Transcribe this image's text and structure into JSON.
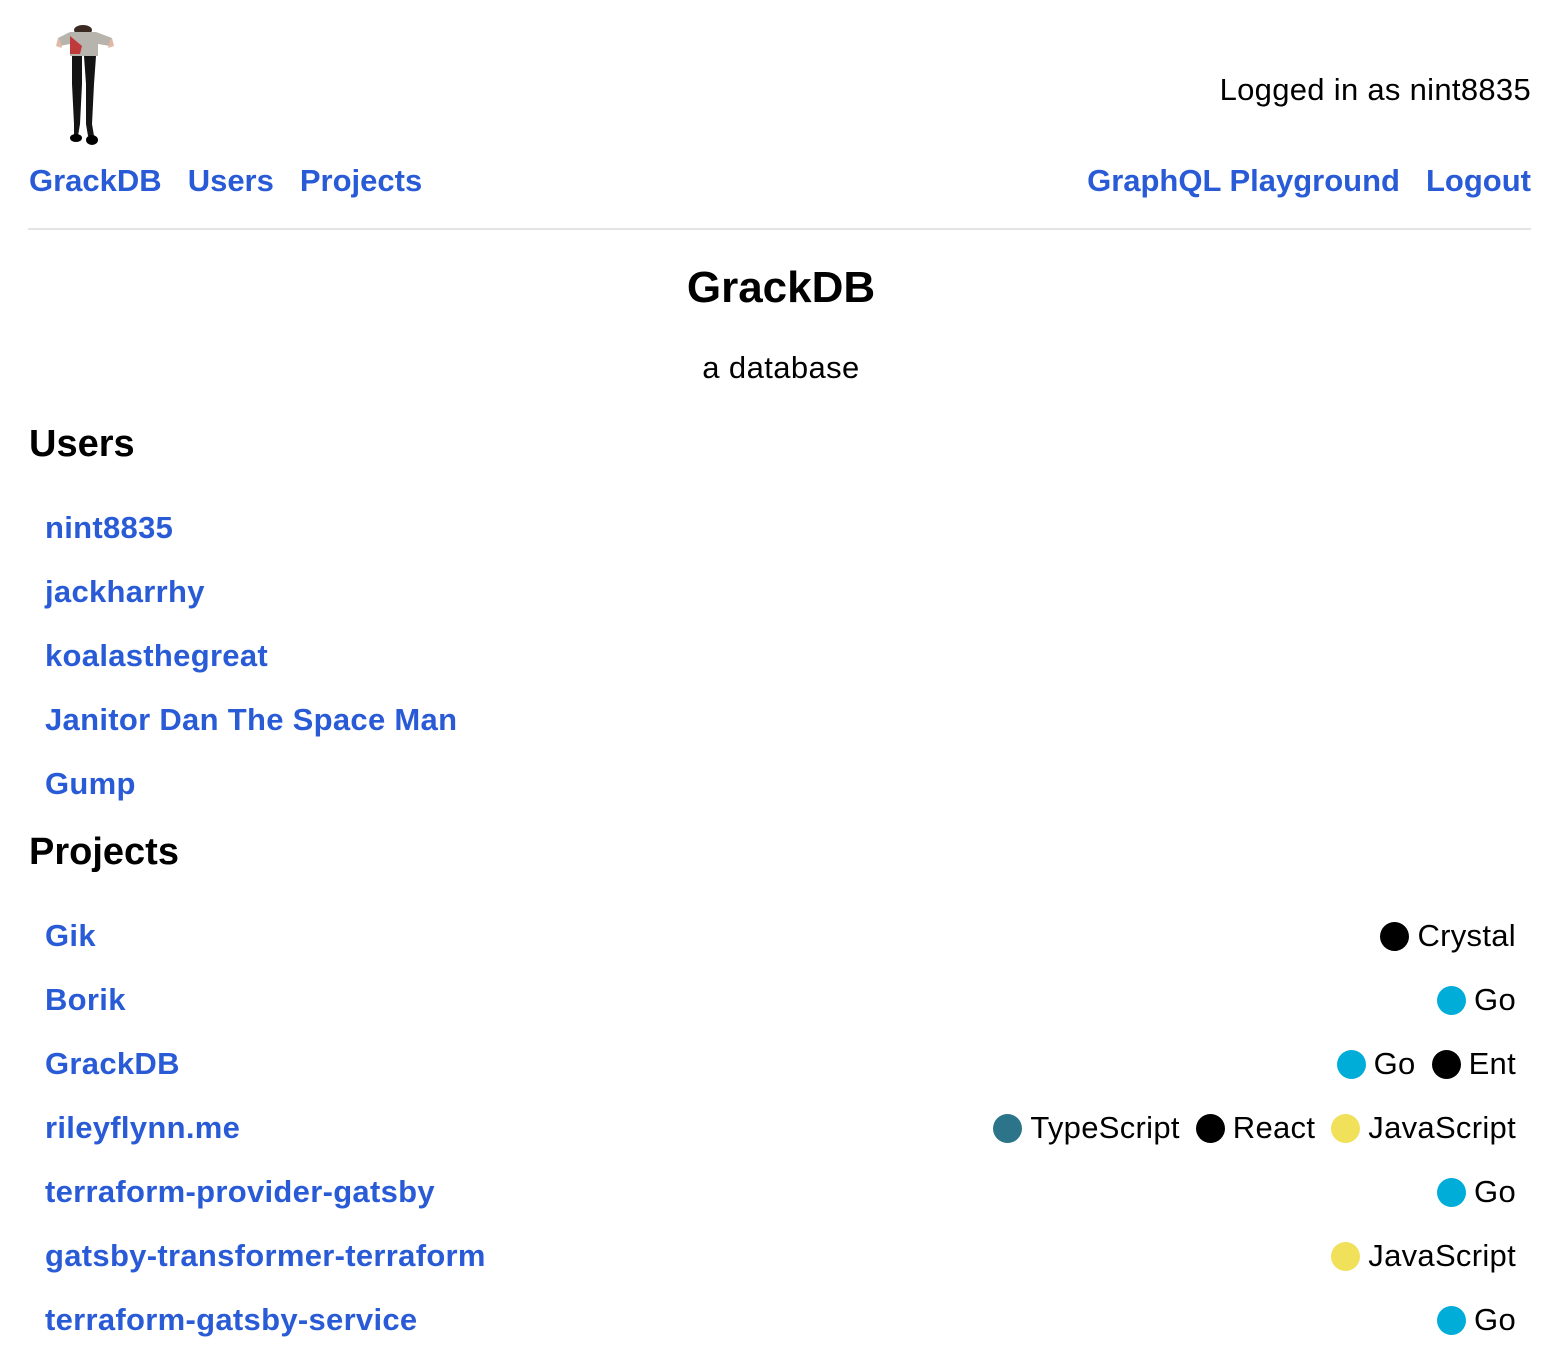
{
  "header": {
    "logged_in_text": "Logged in as nint8835",
    "nav_left": [
      {
        "label": "GrackDB"
      },
      {
        "label": "Users"
      },
      {
        "label": "Projects"
      }
    ],
    "nav_right": [
      {
        "label": "GraphQL Playground"
      },
      {
        "label": "Logout"
      }
    ]
  },
  "main": {
    "title": "GrackDB",
    "subtitle": "a database",
    "users_heading": "Users",
    "users": [
      {
        "name": "nint8835"
      },
      {
        "name": "jackharrhy"
      },
      {
        "name": "koalasthegreat"
      },
      {
        "name": "Janitor Dan The Space Man"
      },
      {
        "name": "Gump"
      }
    ],
    "projects_heading": "Projects",
    "projects": [
      {
        "name": "Gik",
        "tags": [
          {
            "label": "Crystal",
            "color": "#000000"
          }
        ]
      },
      {
        "name": "Borik",
        "tags": [
          {
            "label": "Go",
            "color": "#00ADD8"
          }
        ]
      },
      {
        "name": "GrackDB",
        "tags": [
          {
            "label": "Go",
            "color": "#00ADD8"
          },
          {
            "label": "Ent",
            "color": "#000000"
          }
        ]
      },
      {
        "name": "rileyflynn.me",
        "tags": [
          {
            "label": "TypeScript",
            "color": "#2b7489"
          },
          {
            "label": "React",
            "color": "#000000"
          },
          {
            "label": "JavaScript",
            "color": "#f1e05a"
          }
        ]
      },
      {
        "name": "terraform-provider-gatsby",
        "tags": [
          {
            "label": "Go",
            "color": "#00ADD8"
          }
        ]
      },
      {
        "name": "gatsby-transformer-terraform",
        "tags": [
          {
            "label": "JavaScript",
            "color": "#f1e05a"
          }
        ]
      },
      {
        "name": "terraform-gatsby-service",
        "tags": [
          {
            "label": "Go",
            "color": "#00ADD8"
          }
        ]
      }
    ]
  },
  "colors": {
    "link": "#2a5bd7",
    "divider": "#e4e4e4"
  }
}
